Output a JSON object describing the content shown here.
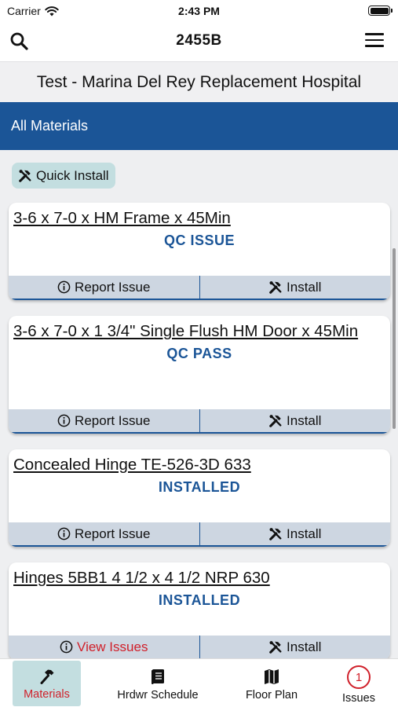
{
  "status_bar": {
    "carrier": "Carrier",
    "time": "2:43 PM"
  },
  "nav": {
    "title": "2455B",
    "search_icon": "search-icon",
    "menu_icon": "hamburger-menu-icon"
  },
  "project": {
    "name": "Test - Marina Del Rey Replacement Hospital"
  },
  "section": {
    "title": "All Materials"
  },
  "quick_install": {
    "label": "Quick Install",
    "icon": "tools-icon"
  },
  "materials": [
    {
      "title": "3-6 x 7-0 x HM Frame x 45Min",
      "status": "QC ISSUE",
      "left_action": "Report Issue",
      "right_action": "Install"
    },
    {
      "title": "3-6 x 7-0 x 1 3/4\" Single Flush HM Door x 45Min",
      "status": "QC PASS",
      "left_action": "Report Issue",
      "right_action": "Install"
    },
    {
      "title": "Concealed Hinge TE-526-3D 633",
      "status": "INSTALLED",
      "left_action": "Report Issue",
      "right_action": "Install"
    },
    {
      "title": "Hinges 5BB1 4 1/2 x 4 1/2 NRP 630",
      "status": "INSTALLED",
      "left_action": "View Issues",
      "right_action": "Install"
    }
  ],
  "tabs": [
    {
      "label": "Materials",
      "icon": "hammer-icon",
      "active": true
    },
    {
      "label": "Hrdwr Schedule",
      "icon": "book-icon"
    },
    {
      "label": "Floor Plan",
      "icon": "map-icon"
    },
    {
      "label": "Issues",
      "icon": "issues-count-icon",
      "badge": "1"
    }
  ],
  "colors": {
    "primary": "#1b5597",
    "danger": "#d0202a",
    "chip": "#c3dee0",
    "action_bar": "#cdd6e1"
  }
}
